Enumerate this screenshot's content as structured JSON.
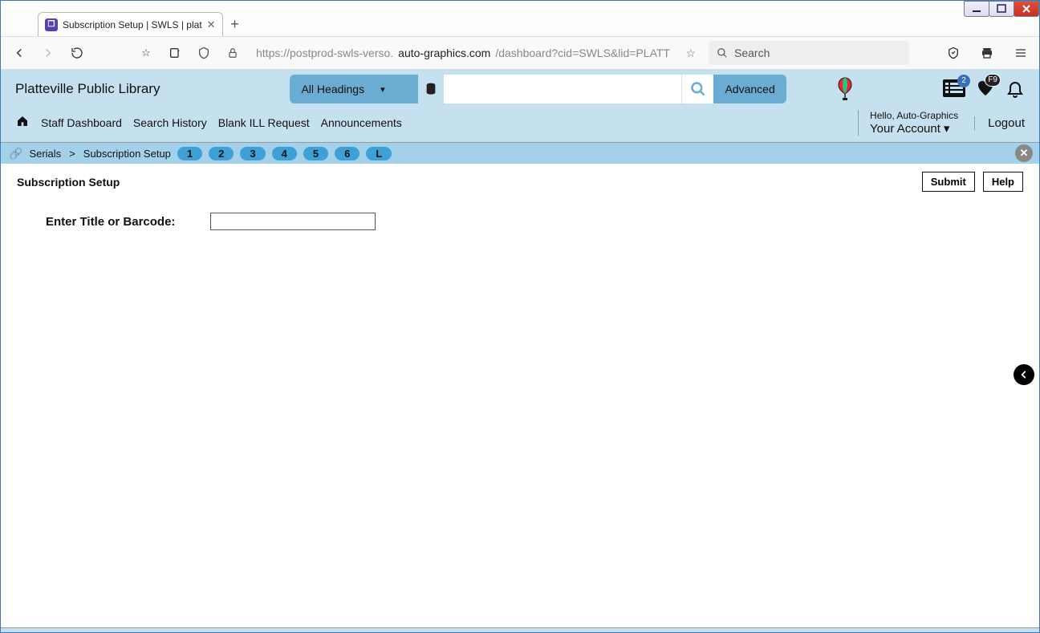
{
  "window": {
    "tab_title": "Subscription Setup | SWLS | plat",
    "url_pre": "https://postprod-swls-verso.",
    "url_host": "auto-graphics.com",
    "url_path": "/dashboard?cid=SWLS&lid=PLATT",
    "search_placeholder": "Search"
  },
  "library_name": "Platteville Public Library",
  "search": {
    "headings_label": "All Headings",
    "advanced_label": "Advanced",
    "input_value": ""
  },
  "header_badges": {
    "pair_count": "2",
    "heart_label": "F9"
  },
  "nav": {
    "items": [
      "Staff Dashboard",
      "Search History",
      "Blank ILL Request",
      "Announcements"
    ]
  },
  "account": {
    "hello": "Hello, Auto-Graphics",
    "your_account": "Your Account",
    "logout": "Logout"
  },
  "breadcrumb": {
    "root": "Serials",
    "current": "Subscription Setup",
    "pills": [
      "1",
      "2",
      "3",
      "4",
      "5",
      "6",
      "L"
    ]
  },
  "content": {
    "title": "Subscription Setup",
    "submit": "Submit",
    "help": "Help",
    "input_label": "Enter Title or Barcode:",
    "input_value": ""
  }
}
